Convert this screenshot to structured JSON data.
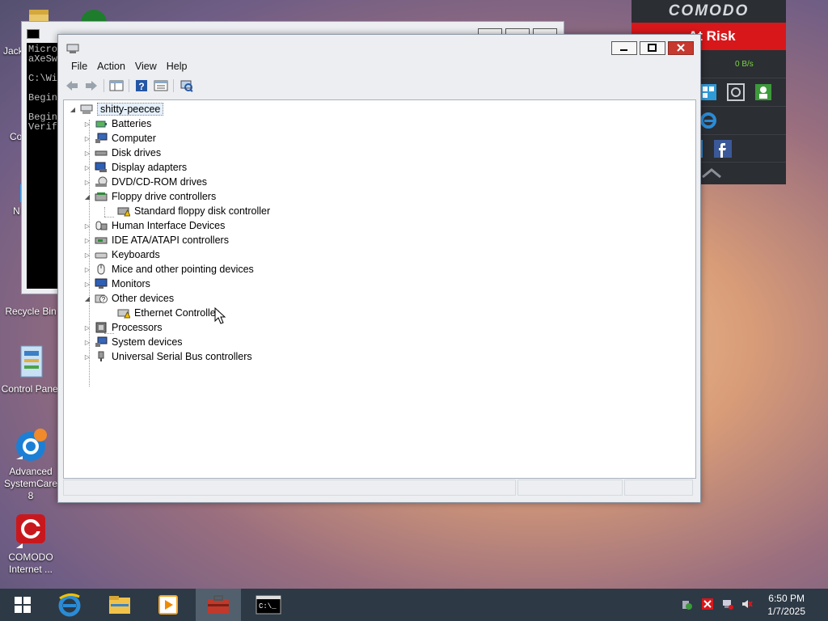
{
  "desktop": {
    "icons": [
      {
        "label": "Jack",
        "name": "jack-folder"
      },
      {
        "label": "Co",
        "name": "co-shortcut"
      },
      {
        "label": "N",
        "name": "n-shortcut"
      },
      {
        "label": "Recycle Bin",
        "name": "recycle-bin"
      },
      {
        "label": "Control Panel",
        "name": "control-panel"
      },
      {
        "label": "Advanced SystemCare 8",
        "name": "advanced-systemcare"
      },
      {
        "label": "COMODO Internet ...",
        "name": "comodo-internet"
      }
    ]
  },
  "cmd": {
    "text": "Micro\naXeSw\n\nC:\\Wi\n\nBegin\n\nBegin\nVerif"
  },
  "comodo": {
    "logo": "COMODO",
    "status": "At Risk",
    "speed": "0 B/s"
  },
  "device_manager": {
    "menu": [
      "File",
      "Action",
      "View",
      "Help"
    ],
    "root": "shitty-peecee",
    "categories": [
      {
        "label": "Batteries"
      },
      {
        "label": "Computer"
      },
      {
        "label": "Disk drives"
      },
      {
        "label": "Display adapters"
      },
      {
        "label": "DVD/CD-ROM drives"
      },
      {
        "label": "Floppy drive controllers",
        "expanded": true,
        "children": [
          "Standard floppy disk controller"
        ]
      },
      {
        "label": "Human Interface Devices"
      },
      {
        "label": "IDE ATA/ATAPI controllers"
      },
      {
        "label": "Keyboards"
      },
      {
        "label": "Mice and other pointing devices"
      },
      {
        "label": "Monitors"
      },
      {
        "label": "Other devices",
        "expanded": true,
        "children": [
          "Ethernet Controller"
        ]
      },
      {
        "label": "Processors"
      },
      {
        "label": "System devices"
      },
      {
        "label": "Universal Serial Bus controllers"
      }
    ]
  },
  "taskbar": {
    "time": "6:50 PM",
    "date": "1/7/2025"
  },
  "colors": {
    "taskbar": "#2d3945",
    "comodo_risk": "#d8171b",
    "close_button": "#c7392f"
  }
}
